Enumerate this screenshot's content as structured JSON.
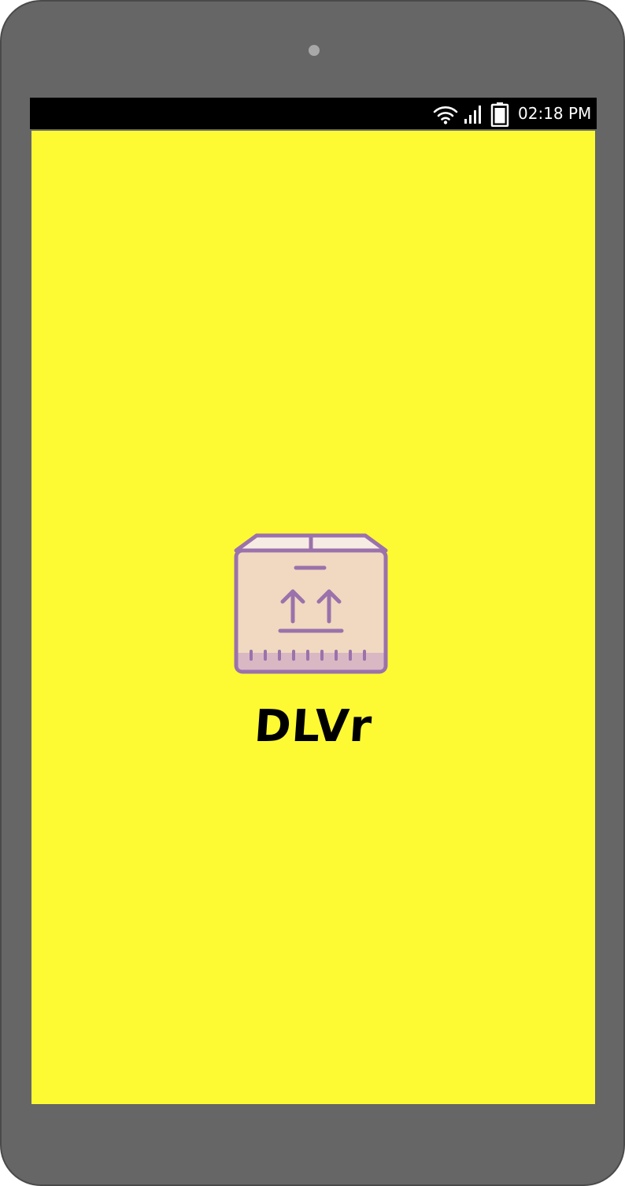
{
  "status_bar": {
    "time": "02:18 PM",
    "icons": [
      "wifi-icon",
      "signal-icon",
      "battery-icon"
    ]
  },
  "splash": {
    "logo_icon": "package-box-icon",
    "title": "DLVr",
    "background_color": "#fdfa33"
  },
  "colors": {
    "device_frame": "#666666",
    "status_bar": "#000000",
    "logo_stroke": "#9b72ab",
    "logo_fill": "#f0d9c0",
    "logo_lid": "#f7ece3",
    "logo_base": "#d9b8c4"
  }
}
